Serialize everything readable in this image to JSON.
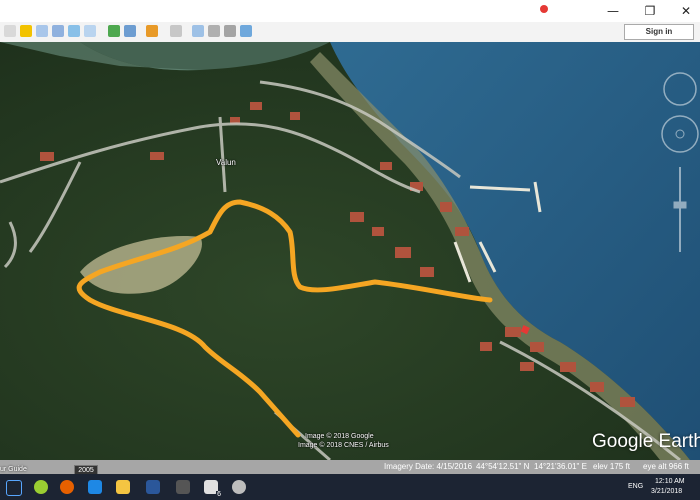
{
  "window": {
    "minimize_glyph": "—",
    "maximize_glyph": "❐",
    "close_glyph": "✕"
  },
  "toolbar": {
    "sign_in_label": "Sign in",
    "icons": [
      "sidebar-icon",
      "placemark-icon",
      "polygon-icon",
      "path-icon",
      "overlay-icon",
      "record-tour-icon",
      "historical-imagery-icon",
      "sun-icon",
      "planets-icon",
      "ruler-icon",
      "email-icon",
      "print-icon",
      "save-image-icon",
      "maps-icon"
    ]
  },
  "map": {
    "place_label": "Valun",
    "copyright": "Image © 2018 Google",
    "copyright_2": "Image © 2018 CNES / Airbus",
    "logo": "Google Earth",
    "path_color": "#f5a623"
  },
  "status": {
    "imagery_date": "Imagery Date: 4/15/2016",
    "lat": "44°54'12.51\" N",
    "lon": "14°21'36.01\" E",
    "elev": "elev  175 ft",
    "eye_alt": "eye alt   966 ft"
  },
  "tour_guide": {
    "label": "ur Guide",
    "year": "2005"
  },
  "taskbar": {
    "apps": [
      "windows-start-icon",
      "search-icon",
      "task-view-icon",
      "spotify-icon",
      "firefox-icon",
      "edge-icon",
      "file-explorer-icon",
      "store-icon",
      "word-icon",
      "excel-icon",
      "calculator-icon",
      "mail-icon",
      "google-earth-icon"
    ],
    "mail_badge": "6",
    "lang": "ENG",
    "time": "12:10 AM",
    "date": "3/21/2018"
  }
}
